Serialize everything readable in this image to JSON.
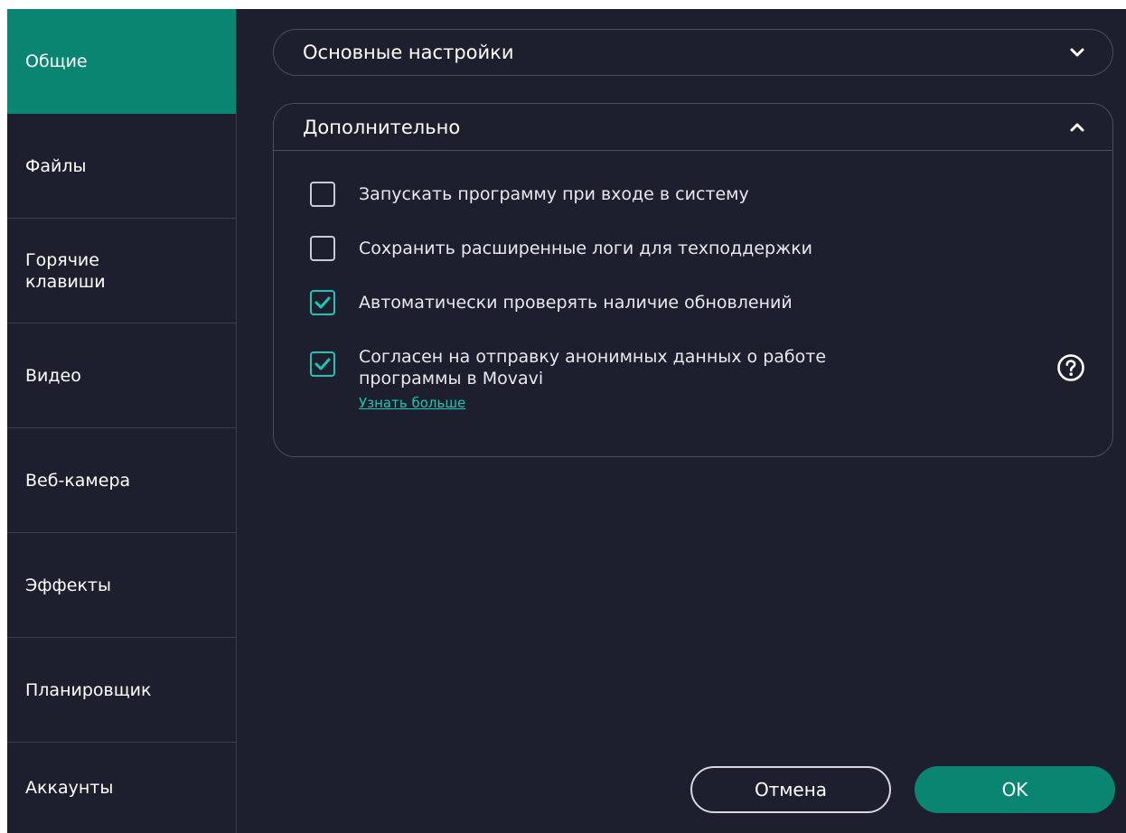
{
  "sidebar": {
    "items": [
      {
        "label": "Общие"
      },
      {
        "label": "Файлы"
      },
      {
        "label": "Горячие\nклавиши"
      },
      {
        "label": "Видео"
      },
      {
        "label": "Веб-камера"
      },
      {
        "label": "Эффекты"
      },
      {
        "label": "Планировщик"
      },
      {
        "label": "Аккаунты"
      }
    ],
    "active_index": 0
  },
  "sections": {
    "basic": {
      "title": "Основные настройки",
      "expanded": false
    },
    "advanced": {
      "title": "Дополнительно",
      "expanded": true,
      "options": [
        {
          "label": "Запускать программу при входе в систему",
          "checked": false
        },
        {
          "label": "Сохранить расширенные логи для техподдержки",
          "checked": false
        },
        {
          "label": "Автоматически проверять наличие обновлений",
          "checked": true
        },
        {
          "label": "Согласен на отправку анонимных данных о работе программы в Movavi",
          "checked": true,
          "link": "Узнать больше"
        }
      ]
    }
  },
  "buttons": {
    "cancel": "Отмена",
    "ok": "OK"
  },
  "colors": {
    "accent": "#0a8571",
    "check": "#19c7b4",
    "background": "#1d1f2e"
  },
  "icons": {
    "collapsed": "chevron-down-icon",
    "expanded": "chevron-up-icon",
    "help": "question-circle-icon",
    "check": "checkmark-icon"
  }
}
